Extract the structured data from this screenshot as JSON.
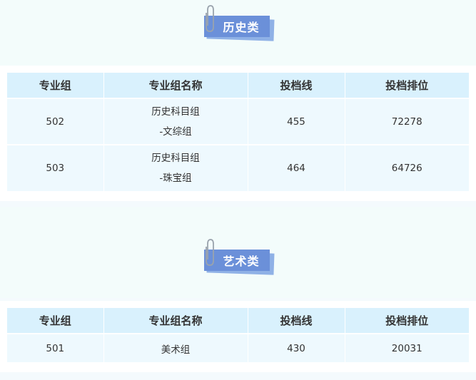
{
  "sections": [
    {
      "title": "历史类",
      "headers": [
        "专业组",
        "专业组名称",
        "投档线",
        "投档排位"
      ],
      "rows": [
        {
          "group": "502",
          "name_line1": "历史科目组",
          "name_line2": "-文综组",
          "score": "455",
          "rank": "72278"
        },
        {
          "group": "503",
          "name_line1": "历史科目组",
          "name_line2": "-珠宝组",
          "score": "464",
          "rank": "64726"
        }
      ]
    },
    {
      "title": "艺术类",
      "headers": [
        "专业组",
        "专业组名称",
        "投档线",
        "投档排位"
      ],
      "rows": [
        {
          "group": "501",
          "name": "美术组",
          "score": "430",
          "rank": "20031"
        }
      ]
    }
  ],
  "colors": {
    "badge": "#6b90d9",
    "badge_shadow": "#8fb1e6",
    "header_bg": "#d9f1fd",
    "cell_bg": "#eef9fe",
    "band_bg": "#f3fcfb"
  }
}
